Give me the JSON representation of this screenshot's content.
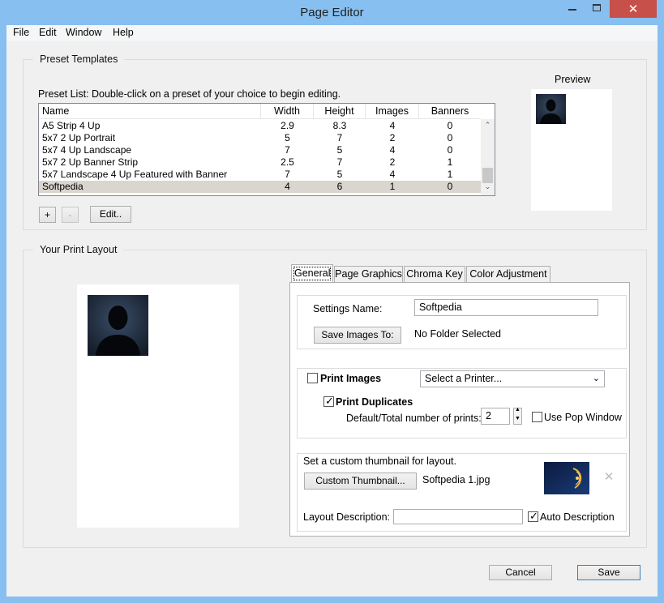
{
  "window": {
    "title": "Page Editor"
  },
  "menu": [
    "File",
    "Edit",
    "Window",
    "Help"
  ],
  "preset_templates": {
    "group_title": "Preset Templates",
    "instruction": "Preset List: Double-click on a preset of your choice to begin editing.",
    "columns": [
      "Name",
      "Width",
      "Height",
      "Images",
      "Banners"
    ],
    "rows": [
      [
        "A5 Strip 4 Up",
        "2.9",
        "8.3",
        "4",
        "0"
      ],
      [
        "5x7 2 Up Portrait",
        "5",
        "7",
        "2",
        "0"
      ],
      [
        "5x7 4 Up Landscape",
        "7",
        "5",
        "4",
        "0"
      ],
      [
        "5x7 2 Up Banner Strip",
        "2.5",
        "7",
        "2",
        "1"
      ],
      [
        "5x7 Landscape 4 Up Featured with Banner",
        "7",
        "5",
        "4",
        "1"
      ],
      [
        "Softpedia",
        "4",
        "6",
        "1",
        "0"
      ]
    ],
    "selected_row": 5,
    "add_label": "+",
    "remove_label": "-",
    "edit_label": "Edit..",
    "preview_label": "Preview"
  },
  "print_layout": {
    "group_title": "Your Print Layout",
    "tabs": [
      "General",
      "Page Graphics",
      "Chroma Key",
      "Color Adjustment"
    ],
    "active_tab": "General",
    "settings_name_label": "Settings Name:",
    "settings_name_value": "Softpedia",
    "save_images_label": "Save Images To:",
    "folder_status": "No Folder Selected",
    "print_images_label": "Print Images",
    "print_images_checked": false,
    "printer_select": "Select a Printer...",
    "print_duplicates_label": "Print Duplicates",
    "print_duplicates_checked": true,
    "num_prints_label": "Default/Total number of prints:",
    "num_prints_value": "2",
    "use_pop_window_label": "Use Pop Window",
    "use_pop_window_checked": false,
    "thumbnail_hint": "Set a custom thumbnail for layout.",
    "custom_thumbnail_label": "Custom Thumbnail...",
    "thumbnail_file": "Softpedia 1.jpg",
    "layout_description_label": "Layout Description:",
    "layout_description_value": "",
    "auto_description_label": "Auto Description",
    "auto_description_checked": true
  },
  "footer": {
    "cancel_label": "Cancel",
    "save_label": "Save"
  },
  "colors": {
    "titlebar": "#87bff0",
    "selection": "#dad5cf",
    "silhouette_bg": "#1e2a3c"
  }
}
